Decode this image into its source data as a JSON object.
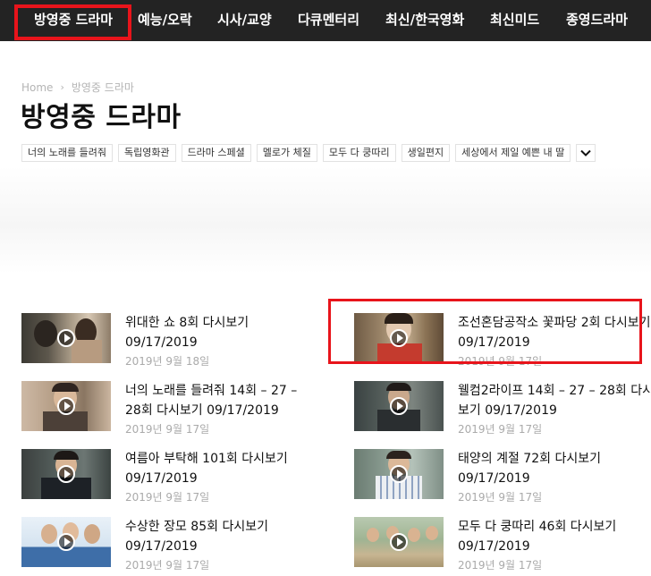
{
  "nav": {
    "items": [
      {
        "label": "방영중 드라마"
      },
      {
        "label": "예능/오락"
      },
      {
        "label": "시사/교양"
      },
      {
        "label": "다큐멘터리"
      },
      {
        "label": "최신/한국영화"
      },
      {
        "label": "최신미드"
      },
      {
        "label": "종영드라마"
      }
    ],
    "highlight_color": "#e8141b"
  },
  "breadcrumb": {
    "home": "Home",
    "current": "방영중 드라마"
  },
  "page": {
    "title": "방영중 드라마"
  },
  "tags": [
    "너의 노래를 들려줘",
    "독립영화관",
    "드라마 스페셜",
    "멜로가 체질",
    "모두 다 쿵따리",
    "생일편지",
    "세상에서 제일 예쁜 내 딸"
  ],
  "posts": [
    {
      "title": "위대한 쇼 8회 다시보기 09/17/2019",
      "date": "2019년 9월 18일",
      "thumbnail": "drama-scene-couple"
    },
    {
      "title": "조선혼담공작소 꽃파당 2회 다시보기 09/17/2019",
      "date": "2019년 9월 17일",
      "thumbnail": "historical-drama-scene"
    },
    {
      "title": "너의 노래를 들려줘 14회 – 27 – 28회 다시보기 09/17/2019",
      "date": "2019년 9월 17일",
      "thumbnail": "drama-scene-man"
    },
    {
      "title": "웰컴2라이프 14회 – 27 – 28회 다시보기 09/17/2019",
      "date": "2019년 9월 17일",
      "thumbnail": "drama-scene-office"
    },
    {
      "title": "여름아 부탁해 101회 다시보기 09/17/2019",
      "date": "2019년 9월 17일",
      "thumbnail": "drama-scene-man-suit"
    },
    {
      "title": "태양의 계절 72회 다시보기 09/17/2019",
      "date": "2019년 9월 17일",
      "thumbnail": "drama-scene-man-shirt"
    },
    {
      "title": "수상한 장모 85회 다시보기 09/17/2019",
      "date": "2019년 9월 17일",
      "thumbnail": "drama-poster-sbs"
    },
    {
      "title": "모두 다 쿵따리 46회 다시보기 09/17/2019",
      "date": "2019년 9월 17일",
      "thumbnail": "drama-scene-group"
    }
  ]
}
